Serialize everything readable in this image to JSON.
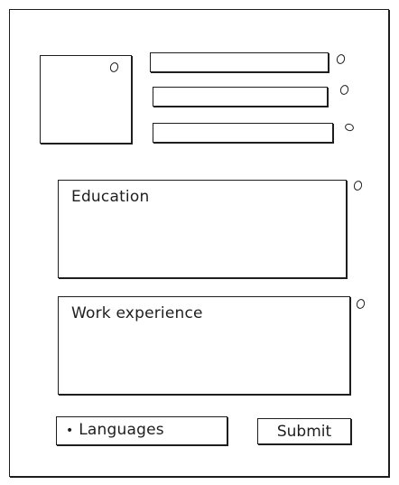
{
  "form": {
    "education_label": "Education",
    "work_label": "Work experience",
    "languages_bullet": "•",
    "languages_label": "Languages",
    "submit_label": "Submit"
  },
  "colors": {
    "ink": "#1e1e1e",
    "background": "#ffffff"
  }
}
